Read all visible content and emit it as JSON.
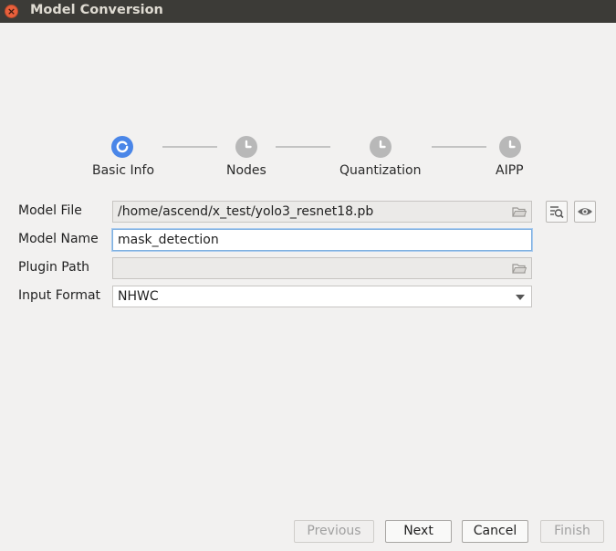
{
  "window": {
    "title": "Model Conversion",
    "close_glyph": "×"
  },
  "stepper": {
    "steps": [
      {
        "label": "Basic Info",
        "state": "active"
      },
      {
        "label": "Nodes",
        "state": "pending"
      },
      {
        "label": "Quantization",
        "state": "pending"
      },
      {
        "label": "AIPP",
        "state": "pending"
      }
    ]
  },
  "form": {
    "model_file": {
      "label": "Model File",
      "value": "/home/ascend/x_test/yolo3_resnet18.pb"
    },
    "model_name": {
      "label": "Model Name",
      "value": "mask_detection"
    },
    "plugin_path": {
      "label": "Plugin Path",
      "value": ""
    },
    "input_format": {
      "label": "Input Format",
      "value": "NHWC"
    }
  },
  "buttons": {
    "previous": "Previous",
    "next": "Next",
    "cancel": "Cancel",
    "finish": "Finish"
  },
  "colors": {
    "accent": "#4a86e8",
    "pending": "#b8b8b8",
    "titlebar": "#3c3b37"
  }
}
